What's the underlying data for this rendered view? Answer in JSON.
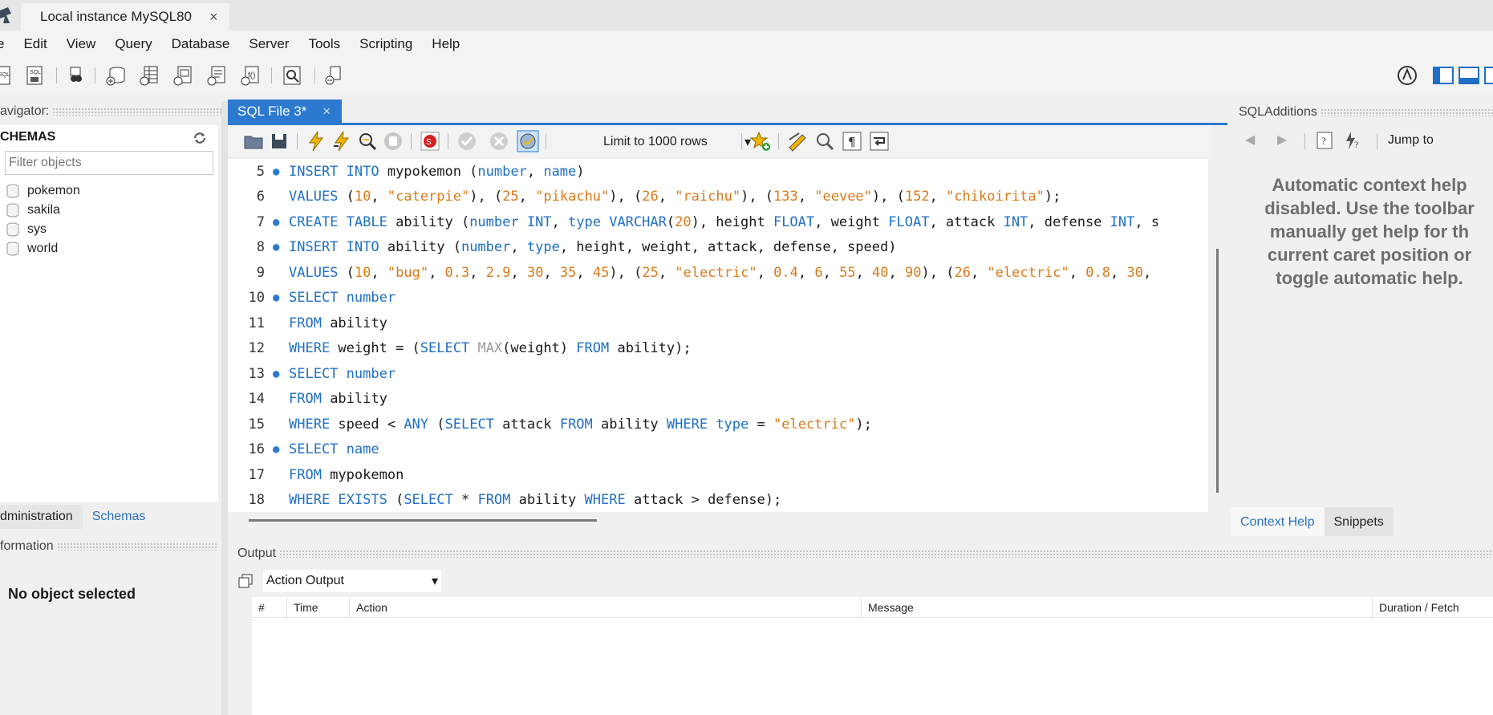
{
  "window": {
    "connection_tab": "Local instance MySQL80",
    "close_glyph": "×"
  },
  "menu": [
    "e",
    "Edit",
    "View",
    "Query",
    "Database",
    "Server",
    "Tools",
    "Scripting",
    "Help"
  ],
  "navigator": {
    "header": "avigator:",
    "schemas_title": "CHEMAS",
    "filter_placeholder": "Filter objects",
    "schemas": [
      "pokemon",
      "sakila",
      "sys",
      "world"
    ],
    "tabs": [
      "dministration",
      "Schemas"
    ],
    "info_header": "formation",
    "no_object": "No object selected"
  },
  "editor": {
    "tab_label": "SQL File 3*",
    "limit_label": "Limit to 1000 rows",
    "lines": [
      {
        "n": "5",
        "dot": true,
        "tokens": [
          [
            "kw",
            "INSERT INTO"
          ],
          [
            "p",
            " mypokemon ("
          ],
          [
            "kw",
            "number"
          ],
          [
            "p",
            ", "
          ],
          [
            "kw",
            "name"
          ],
          [
            "p",
            ")"
          ]
        ]
      },
      {
        "n": "6",
        "dot": false,
        "tokens": [
          [
            "kw",
            "VALUES"
          ],
          [
            "p",
            " ("
          ],
          [
            "num",
            "10"
          ],
          [
            "p",
            ", "
          ],
          [
            "str",
            "\"caterpie\""
          ],
          [
            "p",
            "), ("
          ],
          [
            "num",
            "25"
          ],
          [
            "p",
            ", "
          ],
          [
            "str",
            "\"pikachu\""
          ],
          [
            "p",
            "), ("
          ],
          [
            "num",
            "26"
          ],
          [
            "p",
            ", "
          ],
          [
            "str",
            "\"raichu\""
          ],
          [
            "p",
            "), ("
          ],
          [
            "num",
            "133"
          ],
          [
            "p",
            ", "
          ],
          [
            "str",
            "\"eevee\""
          ],
          [
            "p",
            "), ("
          ],
          [
            "num",
            "152"
          ],
          [
            "p",
            ", "
          ],
          [
            "str",
            "\"chikoirita\""
          ],
          [
            "p",
            ");"
          ]
        ]
      },
      {
        "n": "7",
        "dot": true,
        "tokens": [
          [
            "kw",
            "CREATE TABLE"
          ],
          [
            "p",
            " ability ("
          ],
          [
            "kw",
            "number INT"
          ],
          [
            "p",
            ", "
          ],
          [
            "kw",
            "type VARCHAR"
          ],
          [
            "p",
            "("
          ],
          [
            "num",
            "20"
          ],
          [
            "p",
            "), height "
          ],
          [
            "kw",
            "FLOAT"
          ],
          [
            "p",
            ", weight "
          ],
          [
            "kw",
            "FLOAT"
          ],
          [
            "p",
            ", attack "
          ],
          [
            "kw",
            "INT"
          ],
          [
            "p",
            ", defense "
          ],
          [
            "kw",
            "INT"
          ],
          [
            "p",
            ", s"
          ]
        ]
      },
      {
        "n": "8",
        "dot": true,
        "tokens": [
          [
            "kw",
            "INSERT INTO"
          ],
          [
            "p",
            " ability ("
          ],
          [
            "kw",
            "number"
          ],
          [
            "p",
            ", "
          ],
          [
            "kw",
            "type"
          ],
          [
            "p",
            ", height, weight, attack, defense, speed)"
          ]
        ]
      },
      {
        "n": "9",
        "dot": false,
        "tokens": [
          [
            "kw",
            "VALUES"
          ],
          [
            "p",
            " ("
          ],
          [
            "num",
            "10"
          ],
          [
            "p",
            ", "
          ],
          [
            "str",
            "\"bug\""
          ],
          [
            "p",
            ", "
          ],
          [
            "num",
            "0.3"
          ],
          [
            "p",
            ", "
          ],
          [
            "num",
            "2.9"
          ],
          [
            "p",
            ", "
          ],
          [
            "num",
            "30"
          ],
          [
            "p",
            ", "
          ],
          [
            "num",
            "35"
          ],
          [
            "p",
            ", "
          ],
          [
            "num",
            "45"
          ],
          [
            "p",
            "), ("
          ],
          [
            "num",
            "25"
          ],
          [
            "p",
            ", "
          ],
          [
            "str",
            "\"electric\""
          ],
          [
            "p",
            ", "
          ],
          [
            "num",
            "0.4"
          ],
          [
            "p",
            ", "
          ],
          [
            "num",
            "6"
          ],
          [
            "p",
            ", "
          ],
          [
            "num",
            "55"
          ],
          [
            "p",
            ", "
          ],
          [
            "num",
            "40"
          ],
          [
            "p",
            ", "
          ],
          [
            "num",
            "90"
          ],
          [
            "p",
            "), ("
          ],
          [
            "num",
            "26"
          ],
          [
            "p",
            ", "
          ],
          [
            "str",
            "\"electric\""
          ],
          [
            "p",
            ", "
          ],
          [
            "num",
            "0.8"
          ],
          [
            "p",
            ", "
          ],
          [
            "num",
            "30"
          ],
          [
            "p",
            ","
          ]
        ]
      },
      {
        "n": "10",
        "dot": true,
        "tokens": [
          [
            "kw",
            "SELECT number"
          ]
        ]
      },
      {
        "n": "11",
        "dot": false,
        "tokens": [
          [
            "kw",
            "FROM"
          ],
          [
            "p",
            " ability"
          ]
        ]
      },
      {
        "n": "12",
        "dot": false,
        "tokens": [
          [
            "kw",
            "WHERE"
          ],
          [
            "p",
            " weight = ("
          ],
          [
            "kw",
            "SELECT"
          ],
          [
            "p",
            " "
          ],
          [
            "fn",
            "MAX"
          ],
          [
            "p",
            "(weight) "
          ],
          [
            "kw",
            "FROM"
          ],
          [
            "p",
            " ability);"
          ]
        ]
      },
      {
        "n": "13",
        "dot": true,
        "tokens": [
          [
            "kw",
            "SELECT number"
          ]
        ]
      },
      {
        "n": "14",
        "dot": false,
        "tokens": [
          [
            "kw",
            "FROM"
          ],
          [
            "p",
            " ability"
          ]
        ]
      },
      {
        "n": "15",
        "dot": false,
        "tokens": [
          [
            "kw",
            "WHERE"
          ],
          [
            "p",
            " speed < "
          ],
          [
            "kw",
            "ANY"
          ],
          [
            "p",
            " ("
          ],
          [
            "kw",
            "SELECT"
          ],
          [
            "p",
            " attack "
          ],
          [
            "kw",
            "FROM"
          ],
          [
            "p",
            " ability "
          ],
          [
            "kw",
            "WHERE type"
          ],
          [
            "p",
            " = "
          ],
          [
            "str",
            "\"electric\""
          ],
          [
            "p",
            ");"
          ]
        ]
      },
      {
        "n": "16",
        "dot": true,
        "tokens": [
          [
            "kw",
            "SELECT name"
          ]
        ]
      },
      {
        "n": "17",
        "dot": false,
        "tokens": [
          [
            "kw",
            "FROM"
          ],
          [
            "p",
            " mypokemon"
          ]
        ]
      },
      {
        "n": "18",
        "dot": false,
        "tokens": [
          [
            "kw",
            "WHERE EXISTS"
          ],
          [
            "p",
            " ("
          ],
          [
            "kw",
            "SELECT"
          ],
          [
            "p",
            " * "
          ],
          [
            "kw",
            "FROM"
          ],
          [
            "p",
            " ability "
          ],
          [
            "kw",
            "WHERE"
          ],
          [
            "p",
            " attack > defense);"
          ]
        ]
      }
    ],
    "colors": {
      "keyword": "#1f6fc5",
      "string": "#d97a1a",
      "function": "#9a9a9a",
      "tab_accent": "#2b7ad0"
    }
  },
  "sql_additions": {
    "header": "SQLAdditions",
    "jump_to": "Jump to",
    "help_lines": [
      "Automatic context help",
      "disabled. Use the toolbar",
      "manually get help for th",
      "current caret position or",
      "toggle automatic help."
    ],
    "tabs": [
      "Context Help",
      "Snippets"
    ]
  },
  "output": {
    "header": "Output",
    "select_value": "Action Output",
    "columns": [
      "#",
      "Time",
      "Action",
      "Message",
      "Duration / Fetch"
    ]
  }
}
